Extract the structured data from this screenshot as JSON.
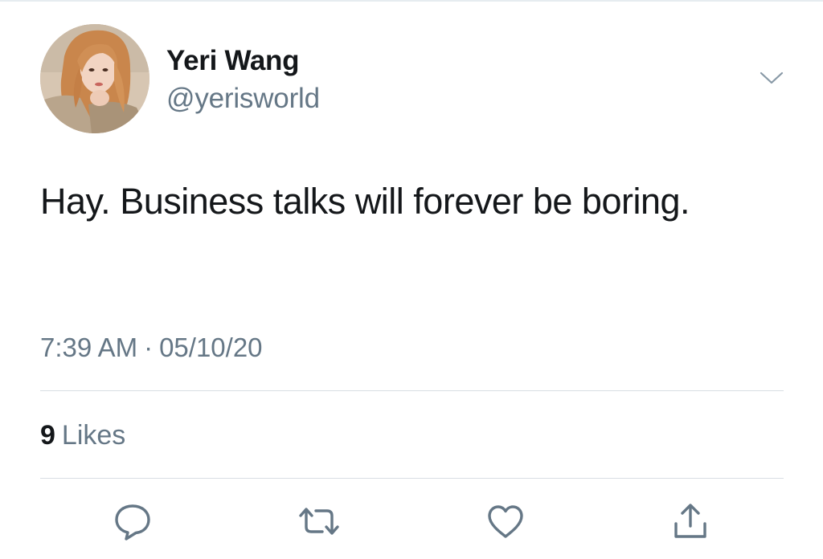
{
  "tweet": {
    "author": {
      "display_name": "Yeri Wang",
      "handle": "@yerisworld"
    },
    "text": "Hay. Business talks will forever be boring.",
    "time": "7:39 AM",
    "separator": "·",
    "date": "05/10/20",
    "likes": {
      "count": "9",
      "label": "Likes"
    }
  },
  "actions": [
    {
      "name": "reply",
      "icon": "speech-bubble-icon"
    },
    {
      "name": "retweet",
      "icon": "retweet-arrows-icon"
    },
    {
      "name": "like",
      "icon": "heart-icon"
    },
    {
      "name": "share",
      "icon": "share-upload-icon"
    }
  ],
  "colors": {
    "text_primary": "#14171a",
    "text_secondary": "#657786",
    "divider": "#d8dee3",
    "icon": "#657786",
    "background": "#ffffff"
  }
}
